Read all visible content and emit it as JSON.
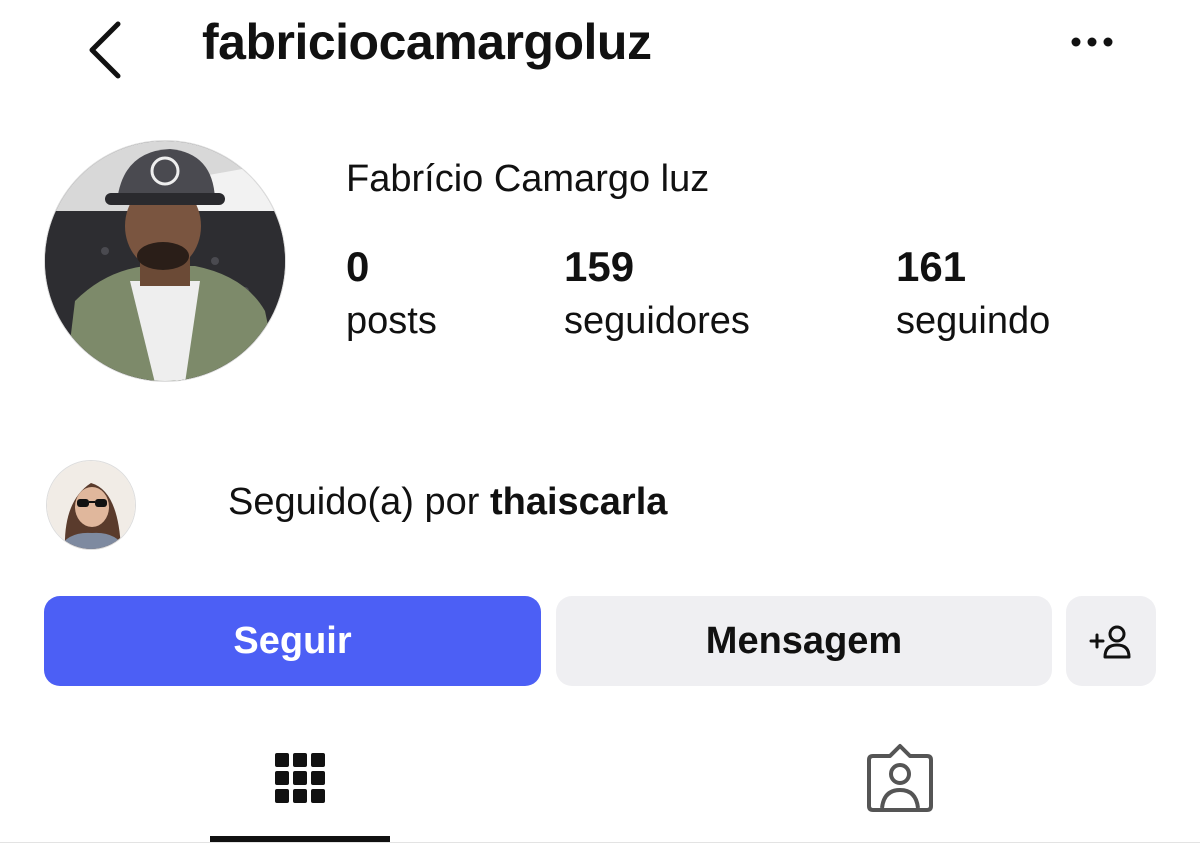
{
  "header": {
    "back_icon": "chevron-left-icon",
    "username": "fabriciocamargoluz",
    "more_icon": "more-dots-icon"
  },
  "profile": {
    "display_name": "Fabrício Camargo luz",
    "stats": [
      {
        "value": "0",
        "label": "posts"
      },
      {
        "value": "159",
        "label": "seguidores"
      },
      {
        "value": "161",
        "label": "seguindo"
      }
    ]
  },
  "followed_by": {
    "prefix": "Seguido(a) por",
    "user": "thaiscarla"
  },
  "actions": {
    "follow_label": "Seguir",
    "message_label": "Mensagem",
    "add_friend_icon": "add-person-icon",
    "follow_color": "#4c5ff5",
    "secondary_color": "#efeff2"
  },
  "tabs": {
    "grid_icon": "grid-icon",
    "tagged_icon": "tagged-person-icon",
    "active": "grid"
  }
}
